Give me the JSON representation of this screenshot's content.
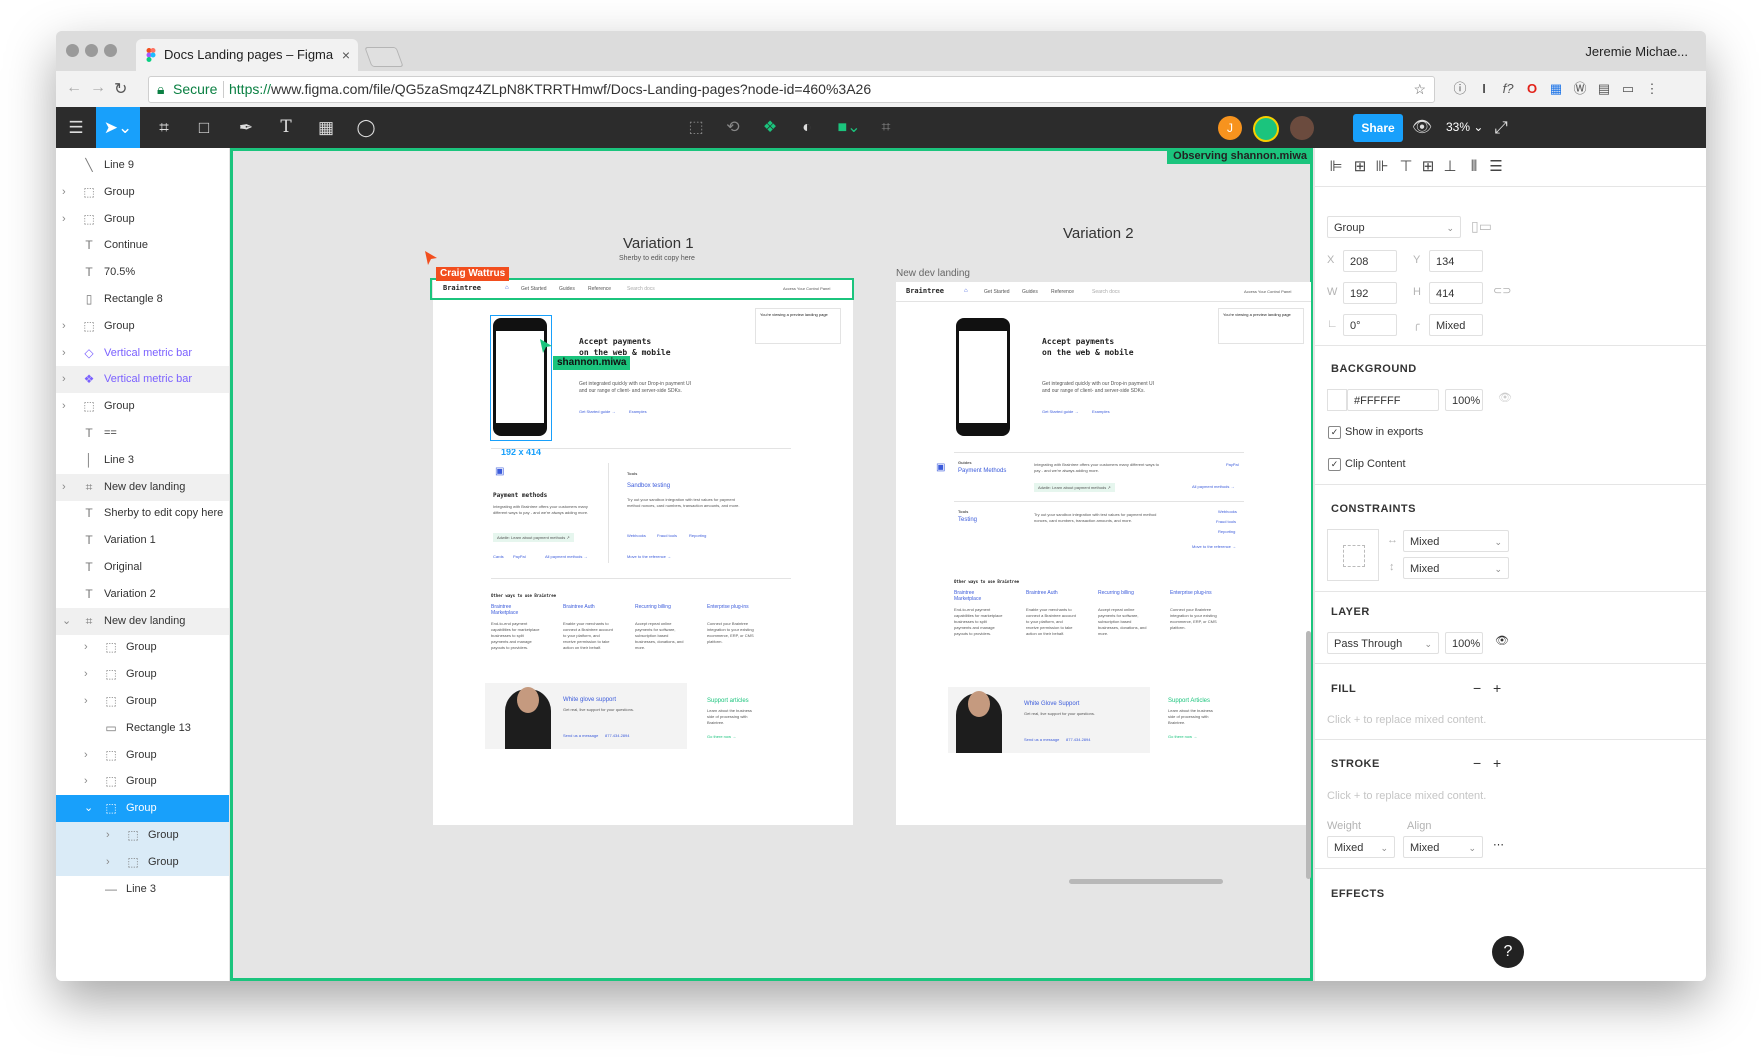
{
  "browser": {
    "tab_title": "Docs Landing pages – Figma",
    "tab_close": "×",
    "user_name": "Jeremie Michae...",
    "secure_label": "Secure",
    "url_scheme": "https://",
    "url_rest": "www.figma.com/file/QG5zaSmqz4ZLpN8KTRRTHmwf/Docs-Landing-pages?node-id=460%3A26"
  },
  "toolbar": {
    "share_label": "Share",
    "zoom": "33%",
    "avatar_initial": "J",
    "colors": {
      "accent": "#18a0fb",
      "observe": "#1bc47d",
      "bg": "#2c2c2c"
    }
  },
  "layers": [
    {
      "name": "Line 9",
      "icon": "line-icon",
      "glyph": "╲",
      "caret": "",
      "indent": 0,
      "state": ""
    },
    {
      "name": "Group",
      "icon": "group-icon",
      "glyph": "⬚",
      "caret": "›",
      "indent": 0,
      "state": ""
    },
    {
      "name": "Group",
      "icon": "group-icon",
      "glyph": "⬚",
      "caret": "›",
      "indent": 0,
      "state": ""
    },
    {
      "name": "Continue",
      "icon": "text-icon",
      "glyph": "T",
      "caret": "",
      "indent": 0,
      "state": ""
    },
    {
      "name": "70.5%",
      "icon": "text-icon",
      "glyph": "T",
      "caret": "",
      "indent": 0,
      "state": ""
    },
    {
      "name": "Rectangle 8",
      "icon": "rectangle-icon",
      "glyph": "▯",
      "caret": "",
      "indent": 0,
      "state": ""
    },
    {
      "name": "Group",
      "icon": "group-icon",
      "glyph": "⬚",
      "caret": "›",
      "indent": 0,
      "state": ""
    },
    {
      "name": "Vertical metric bar",
      "icon": "component-icon",
      "glyph": "◇",
      "caret": "›",
      "indent": 0,
      "state": "purple"
    },
    {
      "name": "Vertical metric bar",
      "icon": "component-icon",
      "glyph": "❖",
      "caret": "›",
      "indent": 0,
      "state": "purple hl"
    },
    {
      "name": "Group",
      "icon": "group-icon",
      "glyph": "⬚",
      "caret": "›",
      "indent": 0,
      "state": ""
    },
    {
      "name": "==",
      "icon": "text-icon",
      "glyph": "T",
      "caret": "",
      "indent": 0,
      "state": ""
    },
    {
      "name": "Line 3",
      "icon": "line-icon",
      "glyph": "│",
      "caret": "",
      "indent": 0,
      "state": ""
    },
    {
      "name": "New dev landing",
      "icon": "frame-icon",
      "glyph": "⌗",
      "caret": "›",
      "indent": 0,
      "state": "hl"
    },
    {
      "name": "Sherby to edit copy here",
      "icon": "text-icon",
      "glyph": "T",
      "caret": "",
      "indent": 0,
      "state": ""
    },
    {
      "name": "Variation 1",
      "icon": "text-icon",
      "glyph": "T",
      "caret": "",
      "indent": 0,
      "state": ""
    },
    {
      "name": "Original",
      "icon": "text-icon",
      "glyph": "T",
      "caret": "",
      "indent": 0,
      "state": ""
    },
    {
      "name": "Variation 2",
      "icon": "text-icon",
      "glyph": "T",
      "caret": "",
      "indent": 0,
      "state": ""
    },
    {
      "name": "New dev landing",
      "icon": "frame-icon",
      "glyph": "⌗",
      "caret": "⌄",
      "indent": 0,
      "state": "hl"
    },
    {
      "name": "Group",
      "icon": "group-icon",
      "glyph": "⬚",
      "caret": "›",
      "indent": 1,
      "state": ""
    },
    {
      "name": "Group",
      "icon": "group-icon",
      "glyph": "⬚",
      "caret": "›",
      "indent": 1,
      "state": ""
    },
    {
      "name": "Group",
      "icon": "group-icon",
      "glyph": "⬚",
      "caret": "›",
      "indent": 1,
      "state": ""
    },
    {
      "name": "Rectangle 13",
      "icon": "rectangle-icon",
      "glyph": "▭",
      "caret": "",
      "indent": 1,
      "state": ""
    },
    {
      "name": "Group",
      "icon": "group-icon",
      "glyph": "⬚",
      "caret": "›",
      "indent": 1,
      "state": ""
    },
    {
      "name": "Group",
      "icon": "group-icon",
      "glyph": "⬚",
      "caret": "›",
      "indent": 1,
      "state": ""
    },
    {
      "name": "Group",
      "icon": "group-icon",
      "glyph": "⬚",
      "caret": "⌄",
      "indent": 1,
      "state": "sel"
    },
    {
      "name": "Group",
      "icon": "group-icon",
      "glyph": "⬚",
      "caret": "›",
      "indent": 2,
      "state": "child"
    },
    {
      "name": "Group",
      "icon": "group-icon",
      "glyph": "⬚",
      "caret": "›",
      "indent": 2,
      "state": "child"
    },
    {
      "name": "Line 3",
      "icon": "line-icon",
      "glyph": "—",
      "caret": "",
      "indent": 1,
      "state": ""
    }
  ],
  "canvas": {
    "observing": "Observing shannon.miwa",
    "variation1_title": "Variation 1",
    "variation1_sub": "Sherby to edit copy here",
    "variation2_title": "Variation 2",
    "frame2_label": "New dev landing",
    "cursor1": "Craig Wattrus",
    "cursor2": "shannon.miwa",
    "selection_size": "192 x 414",
    "site": {
      "logo": "Braintree",
      "nav": [
        "Get Started",
        "Guides",
        "Reference"
      ],
      "search": "Search docs",
      "control_panel": "Access Your Control Panel",
      "hero_title_1": "Accept payments",
      "hero_title_2": "on the web & mobile",
      "hero_body_1": "Get integrated quickly with our Drop-in payment UI",
      "hero_body_2": "and our range of client- and server-side SDKs.",
      "hero_link1": "Get Started guide →",
      "hero_link2": "Examples",
      "preview_note": "You're viewing a preview landing page",
      "pm_title": "Payment methods",
      "pm_body": "Integrating with Braintree offers your customers many different ways to pay - and we're always adding more.",
      "pm_badge": "Adwile: Learn about payment methods ↗",
      "pm_links": [
        "Cards",
        "PayPal",
        "All payment methods →"
      ],
      "tools_label": "Tools",
      "tools_title": "Sandbox testing",
      "tools_body": "Try out your sandbox integration with test values for payment method nonces, card numbers, transaction amounts, and more.",
      "tools_links": [
        "Webhooks",
        "Fraud tools",
        "Reporting",
        "Move to the reference →"
      ],
      "other_title": "Other ways to use Braintree",
      "other_cols": [
        {
          "title": "Braintree Marketplace",
          "body": "End-to-end payment capabilities for marketplace businesses to split payments and manage payouts to providers."
        },
        {
          "title": "Braintree Auth",
          "body": "Enable your merchants to connect a Braintree account to your platform, and receive permission to take action on their behalf."
        },
        {
          "title": "Recurring billing",
          "body": "Accept repeat online payments for software, subscription based businesses, donations, and more."
        },
        {
          "title": "Enterprise plug-ins",
          "body": "Connect your Braintree integration to your existing ecommerce, ERP, or CMS platform."
        }
      ],
      "support_title": "White glove support",
      "support_body": "Get real, live support for your questions.",
      "support_links": [
        "Send us a message",
        "877.434.2894"
      ],
      "articles_title": "Support articles",
      "articles_body": "Learn about the business side of processing with Braintree.",
      "articles_link": "Go there now →",
      "v2_guides": "Guides",
      "v2_pm_title": "Payment Methods",
      "v2_tools_title": "Testing",
      "v2_support_title": "White Glove Support",
      "v2_articles_title": "Support Articles"
    }
  },
  "properties": {
    "layer_type": "Group",
    "x": "208",
    "y": "134",
    "w": "192",
    "h": "414",
    "rotation": "0°",
    "radius": "Mixed",
    "labels": {
      "x": "X",
      "y": "Y",
      "w": "W",
      "h": "H"
    },
    "background_heading": "BACKGROUND",
    "bg_color": "#FFFFFF",
    "bg_opacity": "100%",
    "show_exports": "Show in exports",
    "clip_content": "Clip Content",
    "constraints_heading": "CONSTRAINTS",
    "constraint_h": "Mixed",
    "constraint_v": "Mixed",
    "layer_heading": "LAYER",
    "blend": "Pass Through",
    "layer_opacity": "100%",
    "fill_heading": "FILL",
    "fill_hint": "Click + to replace mixed content.",
    "stroke_heading": "STROKE",
    "stroke_hint": "Click + to replace mixed content.",
    "weight_label": "Weight",
    "align_label": "Align",
    "weight": "Mixed",
    "align": "Mixed",
    "effects_heading": "EFFECTS",
    "help": "?"
  }
}
